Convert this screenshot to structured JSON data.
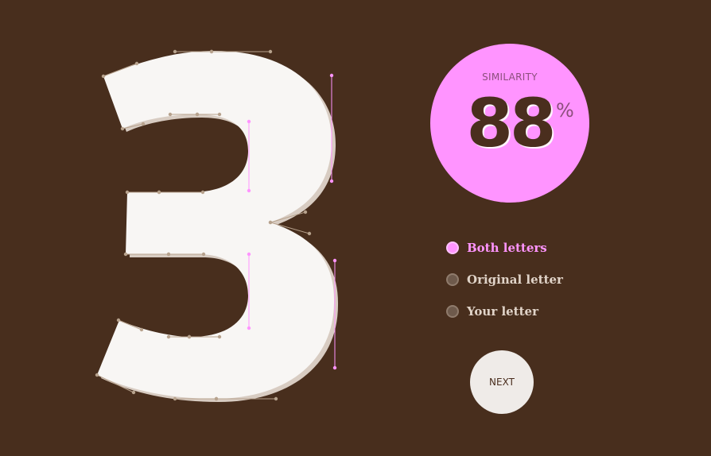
{
  "colors": {
    "background": "#482e1d",
    "glyph_fill": "#f8f6f4",
    "glyph_shadow": "#d8ccc2",
    "accent_pink": "#ff94ff",
    "tan": "#b7a28d",
    "dark_brown": "#4a2e1e",
    "muted_dot": "#6e5a4c",
    "light_text": "#e0d3c8",
    "button_bg": "#efebe8"
  },
  "glyph": {
    "character": "3"
  },
  "score": {
    "label": "SIMILARITY",
    "value": "88",
    "unit": "%"
  },
  "legend": {
    "items": [
      {
        "label": "Both letters",
        "active": true
      },
      {
        "label": "Original letter",
        "active": false
      },
      {
        "label": "Your letter",
        "active": false
      }
    ]
  },
  "next_button": {
    "label": "NEXT"
  }
}
